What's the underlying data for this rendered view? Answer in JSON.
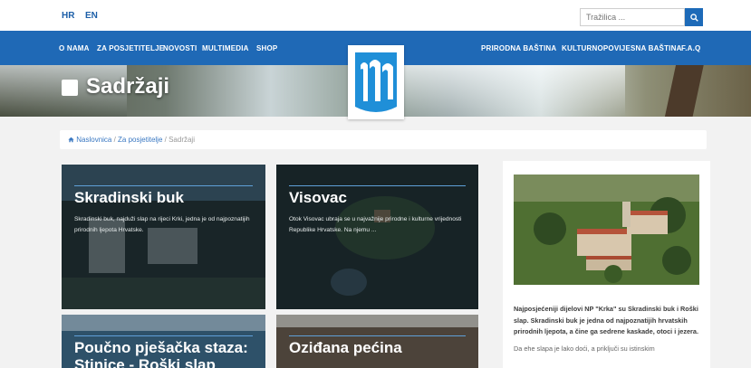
{
  "lang": {
    "hr": "HR",
    "en": "EN"
  },
  "search": {
    "placeholder": "Tražilica ..."
  },
  "nav": {
    "left": [
      "O NAMA",
      "ZA POSJETITELJE",
      "NOVOSTI",
      "MULTIMEDIA",
      "SHOP"
    ],
    "right": [
      "PRIRODNA BAŠTINA",
      "KULTURNOPOVIJESNA BAŠTINA",
      "F.A.Q"
    ]
  },
  "hero": {
    "title": "Sadržaji"
  },
  "breadcrumb": {
    "home": "Naslovnica",
    "sep1": " / ",
    "parent": "Za posjetitelje",
    "sep2": " / ",
    "current": "Sadržaji"
  },
  "cards": [
    {
      "title": "Skradinski buk",
      "text": "Skradinski buk, najduži slap na rijeci Krki, jedna je od najpoznatijih prirodnih ljepota Hrvatske."
    },
    {
      "title": "Visovac",
      "text": "Otok Visovac ubraja se u najvažnije prirodne i kulturne vrijednosti Republike Hrvatske. Na njemu ..."
    },
    {
      "title": "Poučno pješačka staza: Stinice - Roški slap",
      "text": ""
    },
    {
      "title": "Oziđana pećina",
      "text": ""
    }
  ],
  "sidebar": {
    "text": "Najposjećeniji dijelovi NP \"Krka\" su Skradinski buk i Roški slap. Skradinski buk je jedna od najpoznatijih hrvatskih prirodnih ljepota, a čine ga sedrene kaskade, otoci i jezera.",
    "text2": "Da ehe slapa je lako doći, a priključi su istinskim"
  },
  "colors": {
    "brand_blue": "#1f69b6",
    "link": "#3a78c2",
    "card_bg": "#253235",
    "accent_line": "#5fa0d8"
  },
  "icons": {
    "search": "search-icon",
    "home": "home-icon",
    "square": "square-icon"
  }
}
